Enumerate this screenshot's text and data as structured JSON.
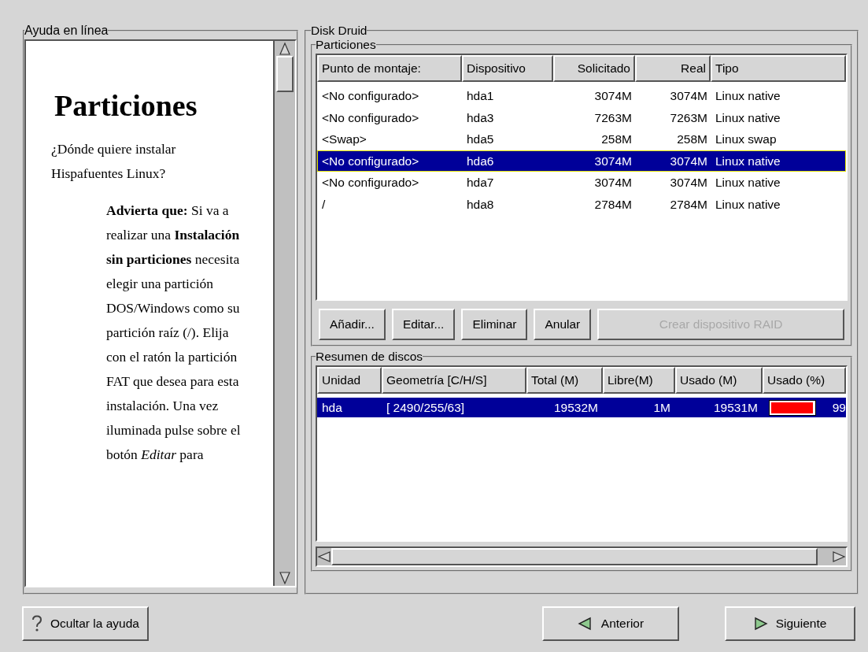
{
  "help": {
    "title": "Ayuda en línea",
    "heading": "Particiones",
    "question": "¿Dónde quiere instalar Hispafuentes Linux?",
    "note": "**Advierta que:** Si va a realizar una **Instalación sin particiones** necesita elegir una partición DOS/Windows como su partición raíz (/). Elija con el ratón la partición FAT que desea para esta instalación. Una vez iluminada pulse sobre el botón *Editar* para"
  },
  "disk_druid": {
    "title": "Disk Druid",
    "partitions": {
      "title": "Particiones",
      "columns": [
        "Punto de montaje:",
        "Dispositivo",
        "Solicitado",
        "Real",
        "Tipo"
      ],
      "rows": [
        {
          "cells": [
            "<No configurado>",
            "hda1",
            "3074M",
            "3074M",
            "Linux native"
          ],
          "selected": false,
          "focused": false
        },
        {
          "cells": [
            "<No configurado>",
            "hda3",
            "7263M",
            "7263M",
            "Linux native"
          ],
          "selected": false,
          "focused": false
        },
        {
          "cells": [
            "<Swap>",
            "hda5",
            "258M",
            "258M",
            "Linux swap"
          ],
          "selected": false,
          "focused": false
        },
        {
          "cells": [
            "<No configurado>",
            "hda6",
            "3074M",
            "3074M",
            "Linux native"
          ],
          "selected": true,
          "focused": true
        },
        {
          "cells": [
            "<No configurado>",
            "hda7",
            "3074M",
            "3074M",
            "Linux native"
          ],
          "selected": false,
          "focused": false
        },
        {
          "cells": [
            "/",
            "hda8",
            "2784M",
            "2784M",
            "Linux native"
          ],
          "selected": false,
          "focused": false
        }
      ],
      "buttons": [
        {
          "label": "Añadir...",
          "disabled": false
        },
        {
          "label": "Editar...",
          "disabled": false
        },
        {
          "label": "Eliminar",
          "disabled": false
        },
        {
          "label": "Anular",
          "disabled": false
        },
        {
          "label": "Crear dispositivo RAID",
          "disabled": true
        }
      ]
    },
    "summary": {
      "title": "Resumen de discos",
      "columns": [
        "Unidad",
        "Geometría [C/H/S]",
        "Total (M)",
        "Libre(M)",
        "Usado (M)",
        "Usado (%)"
      ],
      "rows": [
        {
          "drive": "hda",
          "geometry": "[ 2490/255/63]",
          "total": "19532M",
          "free": "1M",
          "used": "19531M",
          "level": 0.99,
          "percent": "99",
          "selected": true
        }
      ]
    }
  },
  "footer": {
    "help_button": "Ocultar la ayuda",
    "back_button": "Anterior",
    "next_button": "Siguiente"
  }
}
